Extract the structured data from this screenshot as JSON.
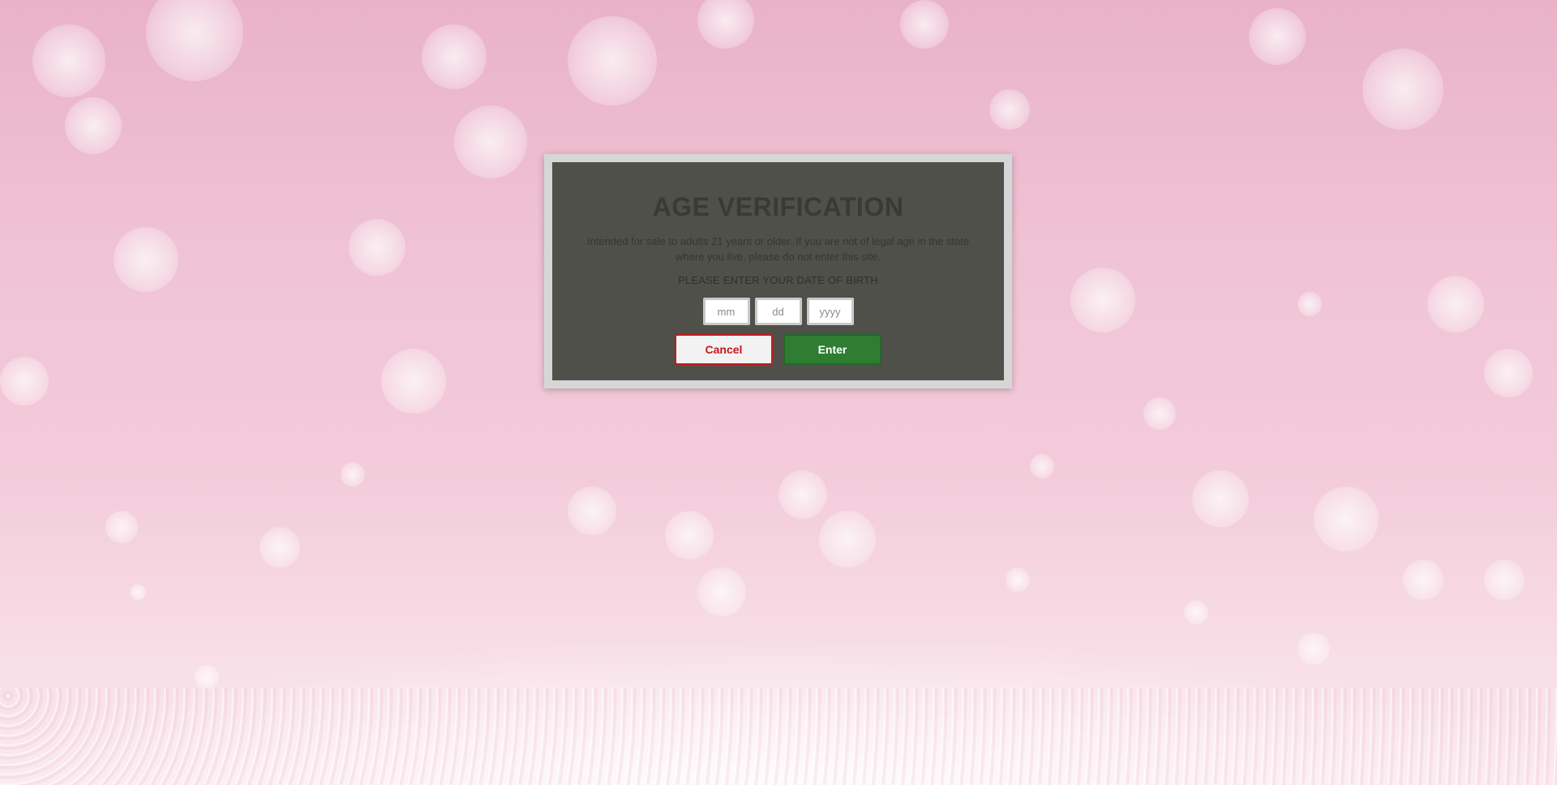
{
  "modal": {
    "title": "AGE VERIFICATION",
    "description": "Intended for sale to adults 21 years or older. If you are not of legal age in the state where you live, please do not enter this site.",
    "prompt": "PLEASE ENTER YOUR DATE OF BIRTH",
    "month_placeholder": "mm",
    "day_placeholder": "dd",
    "year_placeholder": "yyyy",
    "cancel_label": "Cancel",
    "enter_label": "Enter"
  },
  "colors": {
    "modal_background": "#4f5049",
    "frame": "#d6d6d6",
    "cancel_accent": "#c8161d",
    "enter_background": "#2e7d32"
  }
}
